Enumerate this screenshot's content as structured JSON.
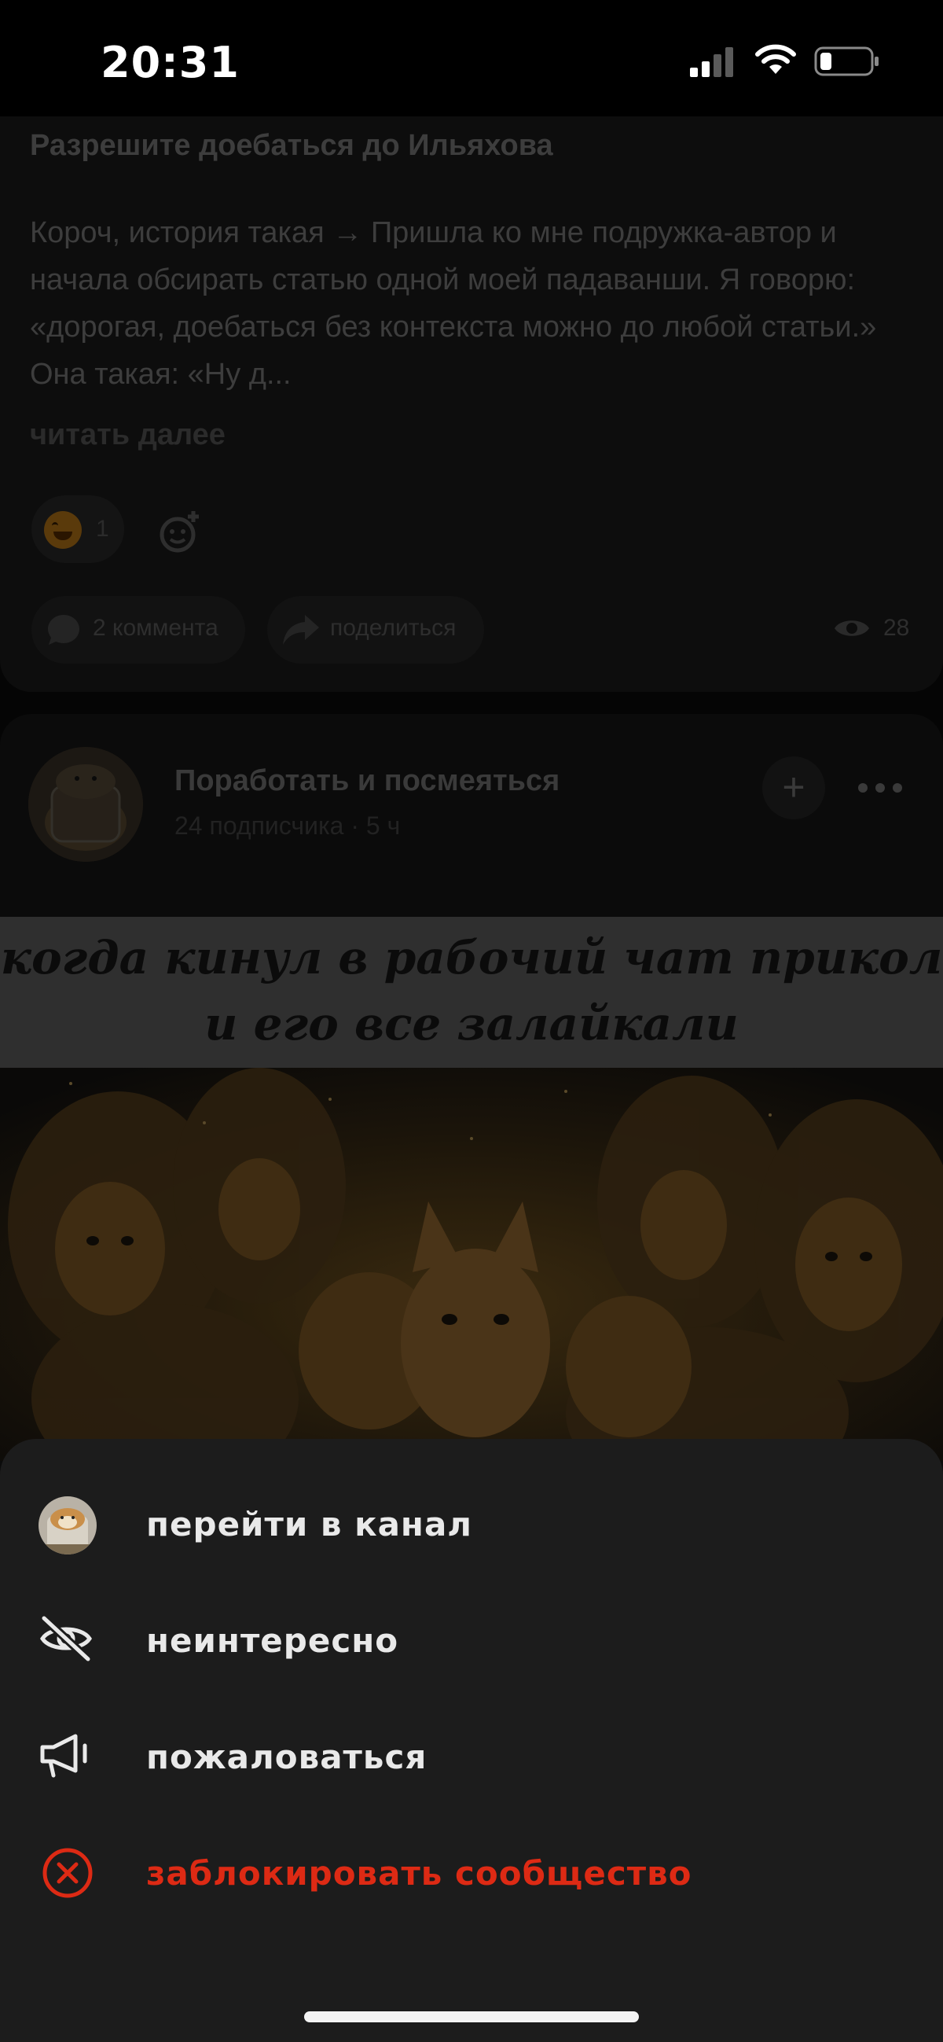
{
  "status_bar": {
    "time": "20:31"
  },
  "post": {
    "title": "Разрешите доебаться до Ильяхова",
    "body": "Короч, история такая → Пришла ко мне подружка-автор и начала обсирать статью одной моей падаванши. Я говорю: «дорогая, доебаться без контекста можно до любой статьи.» Она такая: «Ну д...",
    "read_more": "читать далее",
    "reaction_count": "1",
    "comments_label": "2 коммента",
    "share_label": "поделиться",
    "views": "28"
  },
  "channel_post": {
    "channel_name": "Поработать и посмеяться",
    "meta": "24 подписчика · 5 ч",
    "meme_caption_line1": "когда кинул в рабочий чат прикол",
    "meme_caption_line2": "и его все залайкали"
  },
  "sheet": {
    "items": [
      {
        "label": "перейти в канал",
        "icon": "channel-avatar-icon"
      },
      {
        "label": "неинтересно",
        "icon": "eye-off-icon"
      },
      {
        "label": "пожаловаться",
        "icon": "megaphone-icon"
      },
      {
        "label": "заблокировать сообщество",
        "icon": "block-circle-x-icon"
      }
    ]
  },
  "colors": {
    "danger": "#dd2a14",
    "sheet_bg": "#1c1c1c",
    "menu_text": "#e9e9e9"
  }
}
